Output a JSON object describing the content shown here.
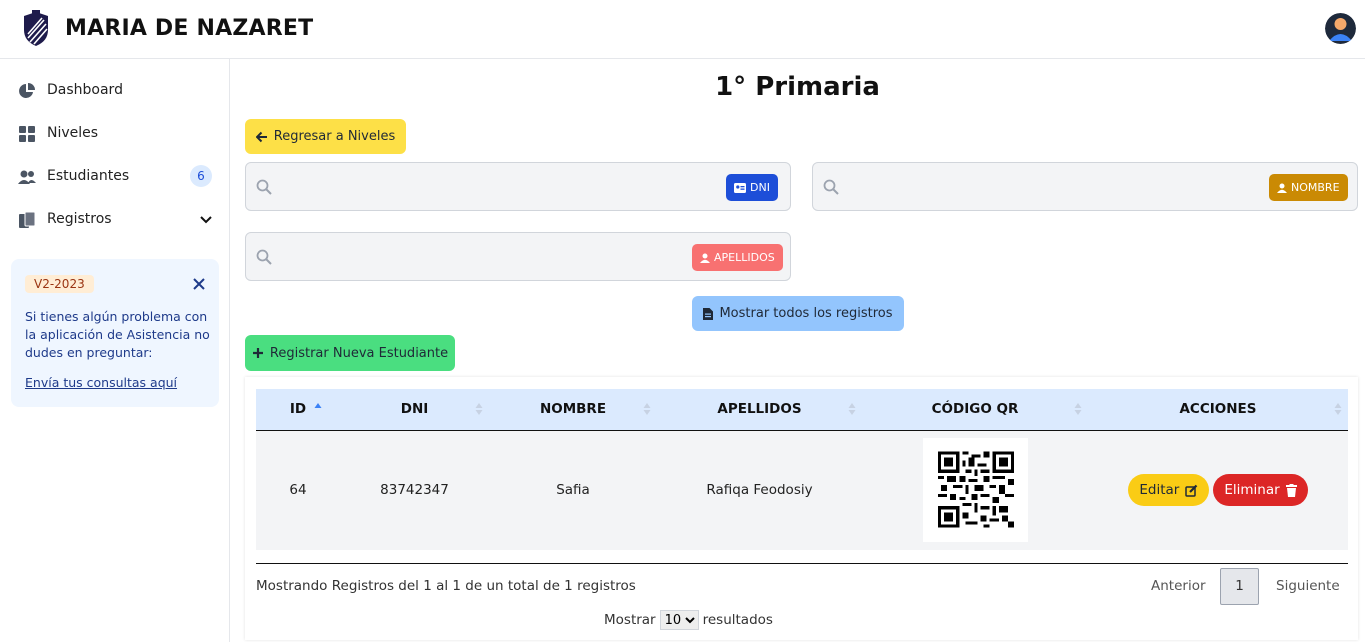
{
  "header": {
    "title": "MARIA DE NAZARET"
  },
  "sidebar": {
    "items": [
      {
        "label": "Dashboard",
        "icon": "pie-chart-icon"
      },
      {
        "label": "Niveles",
        "icon": "grid-icon"
      },
      {
        "label": "Estudiantes",
        "icon": "users-icon",
        "count": "6"
      },
      {
        "label": "Registros",
        "icon": "documents-icon"
      }
    ],
    "help": {
      "version": "V2-2023",
      "text": "Si tienes algún problema con la aplicación de Asistencia no dudes en preguntar:",
      "link": "Envía tus consultas aquí"
    }
  },
  "main": {
    "title": "1° Primaria",
    "back_button": "Regresar a Niveles",
    "search": {
      "dni_tag": "DNI",
      "nombre_tag": "NOMBRE",
      "apellidos_tag": "APELLIDOS"
    },
    "show_all_button": "Mostrar todos los registros",
    "new_button": "Registrar Nueva Estudiante",
    "table": {
      "columns": [
        "ID",
        "DNI",
        "NOMBRE",
        "APELLIDOS",
        "CÓDIGO QR",
        "ACCIONES"
      ],
      "rows": [
        {
          "id": "64",
          "dni": "83742347",
          "nombre": "Safia",
          "apellidos": "Rafiqa Feodosiy"
        }
      ],
      "edit_label": "Editar",
      "delete_label": "Eliminar"
    },
    "footer": {
      "info": "Mostrando Registros del 1 al 1 de un total de 1 registros",
      "prev": "Anterior",
      "page": "1",
      "next": "Siguiente",
      "show_label": "Mostrar",
      "page_size": "10",
      "results_label": "resultados"
    }
  },
  "colors": {
    "back_button": "#fde047",
    "dni_tag": "#1d4ed8",
    "nombre_tag": "#ca8a04",
    "apellidos_tag": "#f87171",
    "show_all": "#93c5fd",
    "new_button": "#4ade80",
    "table_header": "#dbeafe",
    "delete": "#dc2626",
    "edit": "#facc15"
  }
}
